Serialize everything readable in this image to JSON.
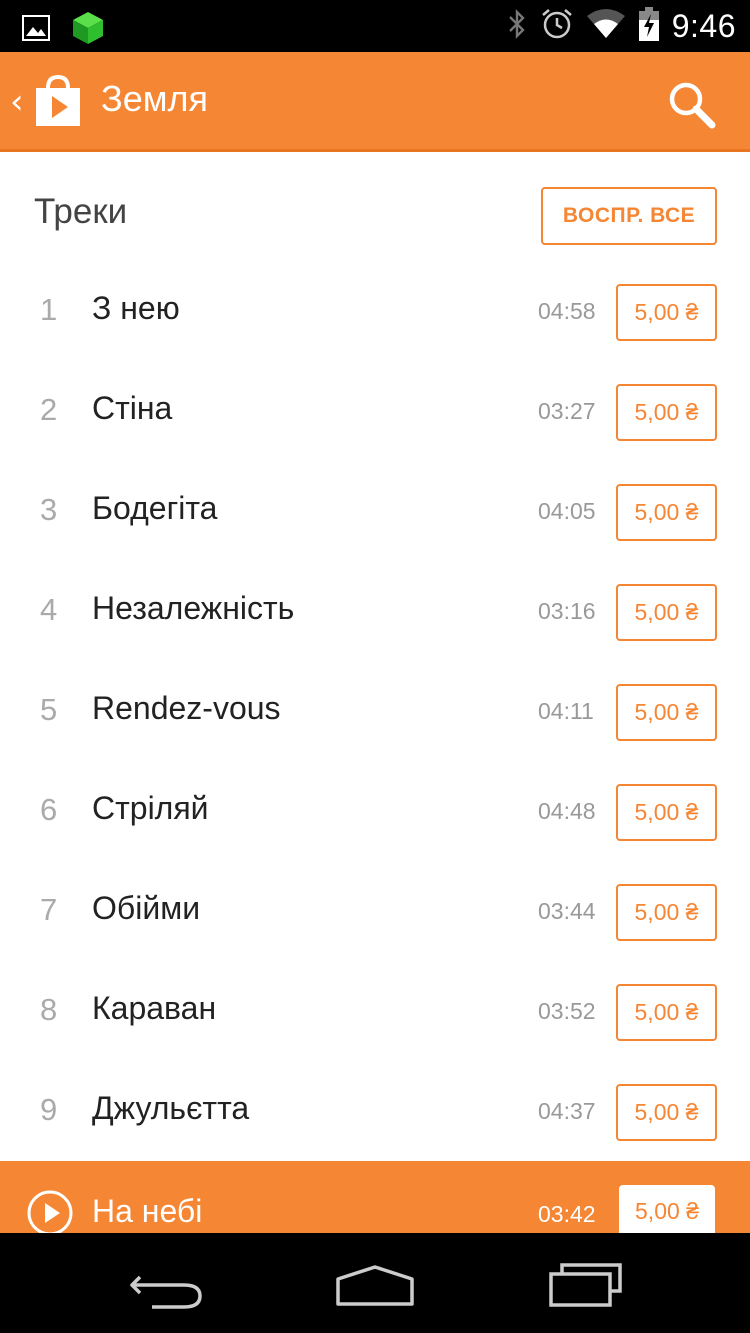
{
  "status_bar": {
    "time": "9:46",
    "icons": [
      "image-notification-icon",
      "cube-app-icon",
      "bluetooth-icon",
      "alarm-icon",
      "wifi-icon",
      "battery-charging-icon"
    ]
  },
  "action_bar": {
    "up_glyph": "‹",
    "title": "Земля",
    "icons": [
      "play-store-logo-icon",
      "search-icon"
    ]
  },
  "section": {
    "title": "Треки",
    "play_all_label": "ВОСПР. ВСЕ"
  },
  "tracks": [
    {
      "num": "1",
      "title": "З нею",
      "duration": "04:58",
      "price": "5,00 ₴"
    },
    {
      "num": "2",
      "title": "Стіна",
      "duration": "03:27",
      "price": "5,00 ₴"
    },
    {
      "num": "3",
      "title": "Бодегіта",
      "duration": "04:05",
      "price": "5,00 ₴"
    },
    {
      "num": "4",
      "title": "Незалежність",
      "duration": "03:16",
      "price": "5,00 ₴"
    },
    {
      "num": "5",
      "title": "Rendez-vous",
      "duration": "04:11",
      "price": "5,00 ₴"
    },
    {
      "num": "6",
      "title": "Стріляй",
      "duration": "04:48",
      "price": "5,00 ₴"
    },
    {
      "num": "7",
      "title": "Обійми",
      "duration": "03:44",
      "price": "5,00 ₴"
    },
    {
      "num": "8",
      "title": "Караван",
      "duration": "03:52",
      "price": "5,00 ₴"
    },
    {
      "num": "9",
      "title": "Джульєтта",
      "duration": "04:37",
      "price": "5,00 ₴"
    }
  ],
  "now_playing": {
    "title": "На небі",
    "duration": "03:42",
    "price": "5,00 ₴",
    "icon": "play-circle-icon"
  },
  "nav_bar": {
    "icons": [
      "back-icon",
      "home-icon",
      "recent-apps-icon"
    ]
  },
  "colors": {
    "accent": "#f58634",
    "status_bar": "#000000",
    "nav_bar": "#000000"
  }
}
